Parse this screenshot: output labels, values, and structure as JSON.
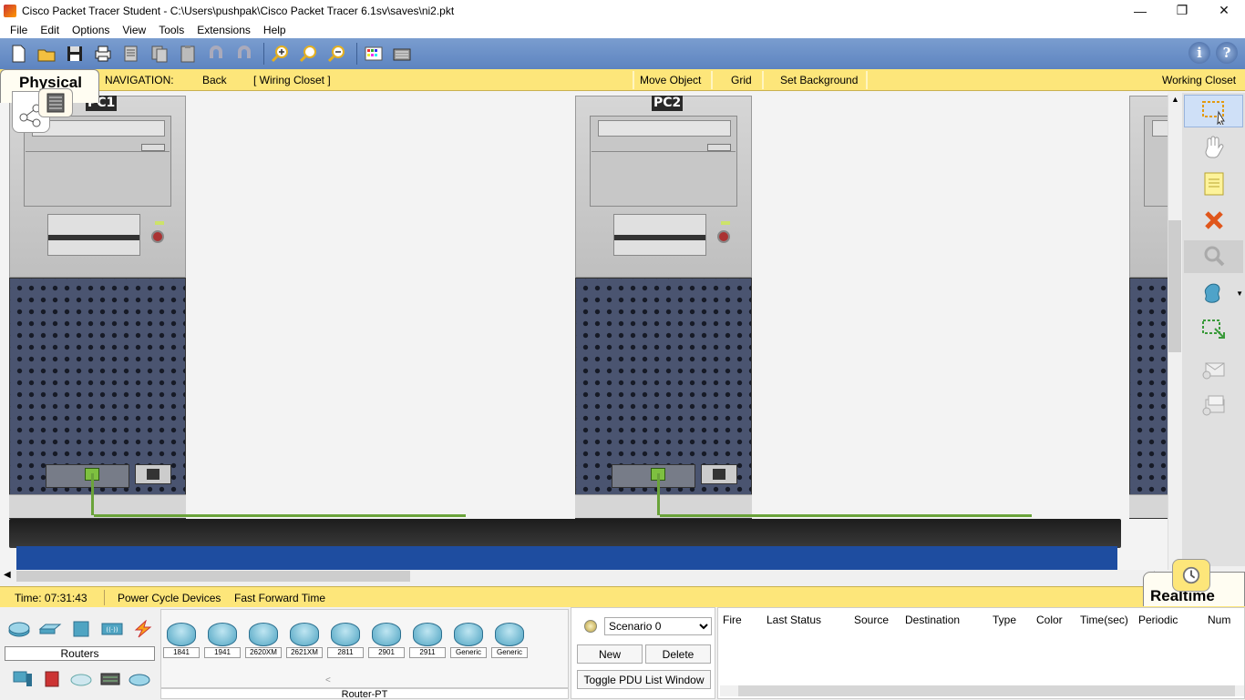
{
  "window": {
    "title": "Cisco Packet Tracer Student - C:\\Users\\pushpak\\Cisco Packet Tracer 6.1sv\\saves\\ni2.pkt",
    "minimize": "—",
    "maximize": "❐",
    "close": "✕"
  },
  "menu": [
    "File",
    "Edit",
    "Options",
    "View",
    "Tools",
    "Extensions",
    "Help"
  ],
  "toolbar": {
    "info_label": "i",
    "help_label": "?"
  },
  "workspace": {
    "tab_label": "Physical"
  },
  "navbar": {
    "navigation_label": "NAVIGATION:",
    "back_label": "Back",
    "location_label": "[ Wiring Closet ]",
    "move_object_label": "Move Object",
    "grid_label": "Grid",
    "set_background_label": "Set Background",
    "working_closet_label": "Working Closet"
  },
  "devices": [
    {
      "label": "PC1"
    },
    {
      "label": "PC2"
    }
  ],
  "status": {
    "time_label": "Time: 07:31:43",
    "power_cycle_label": "Power Cycle Devices",
    "fast_forward_label": "Fast Forward Time",
    "mode_label": "Realtime"
  },
  "device_panel": {
    "category_label": "Routers",
    "models": [
      "1841",
      "1941",
      "2620XM",
      "2621XM",
      "2811",
      "2901",
      "2911",
      "Generic",
      "Generic"
    ],
    "selected_label": "Router-PT"
  },
  "scenario": {
    "selected": "Scenario 0",
    "new_label": "New",
    "delete_label": "Delete",
    "toggle_label": "Toggle PDU List Window"
  },
  "pdu_columns": [
    "Fire",
    "Last Status",
    "Source",
    "Destination",
    "Type",
    "Color",
    "Time(sec)",
    "Periodic",
    "Num"
  ],
  "colors": {
    "accent_yellow": "#fde67a",
    "toolbar_blue": "#5d84c0",
    "cable_green": "#6aa33a"
  }
}
